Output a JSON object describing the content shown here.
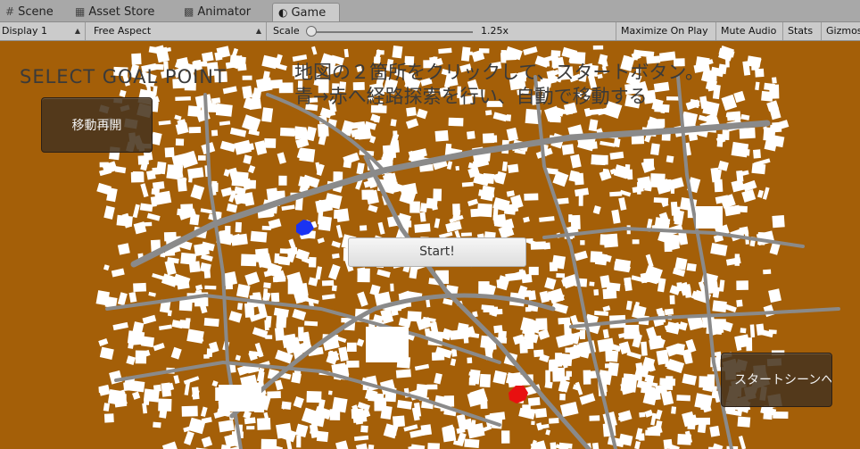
{
  "tabs": [
    {
      "label": "Scene",
      "icon": "hash-icon"
    },
    {
      "label": "Asset Store",
      "icon": "store-icon"
    },
    {
      "label": "Animator",
      "icon": "animator-icon"
    },
    {
      "label": "Game",
      "icon": "game-icon",
      "active": true
    }
  ],
  "toolbar": {
    "display": "Display 1",
    "aspect": "Free Aspect",
    "scale_label": "Scale",
    "scale_value": "1.25x",
    "maximize_on_play": "Maximize On Play",
    "mute_audio": "Mute Audio",
    "stats": "Stats",
    "gizmos": "Gizmos"
  },
  "game": {
    "goal_title": "SELECT  GOAL  POINT",
    "instructions": "地図の２箇所をクリックして、スタートボタン。\n青→赤へ経路探索を行い、自動で移動する",
    "resume_button": "移動再開",
    "start_button": "Start!",
    "start_scene_button": "スタートシーンへ",
    "start_marker_color": "#1a33f2",
    "goal_marker_color": "#e81010",
    "ground_color": "#a45f08",
    "road_color": "#8a8a8a",
    "building_color": "#ffffff"
  }
}
